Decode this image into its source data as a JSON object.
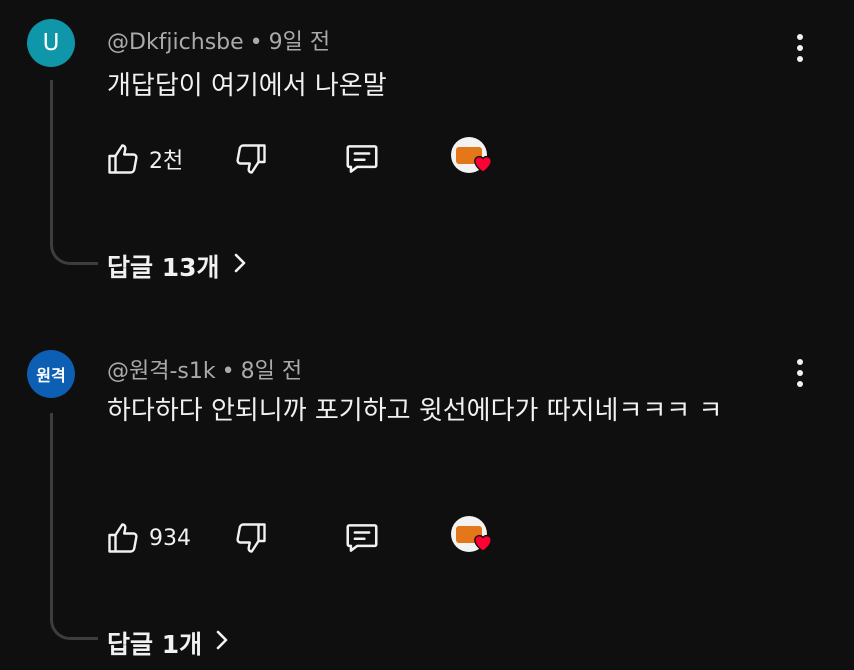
{
  "comments": [
    {
      "avatar_letter": "U",
      "author": "@Dkfjichsbe",
      "time": "9일 전",
      "text": "개답답이 여기에서 나온말",
      "likes": "2천",
      "replies_label": "답글 13개"
    },
    {
      "avatar_letter": "원격",
      "author": "@원격-s1k",
      "time": "8일 전",
      "text": "하다하다 안되니까 포기하고 윗선에다가 따지네ㅋㅋㅋ ㅋ",
      "likes": "934",
      "replies_label": "답글 1개"
    }
  ],
  "separator": "•",
  "icons": [
    "thumbs-up-icon",
    "thumbs-down-icon",
    "reply-comment-icon",
    "creator-heart-icon",
    "more-vert-icon",
    "chevron-right-icon"
  ],
  "colors": {
    "background": "#0f0f0f",
    "text": "#f1f1f1",
    "secondary": "#aaaaaa",
    "heart": "#ff0033"
  }
}
